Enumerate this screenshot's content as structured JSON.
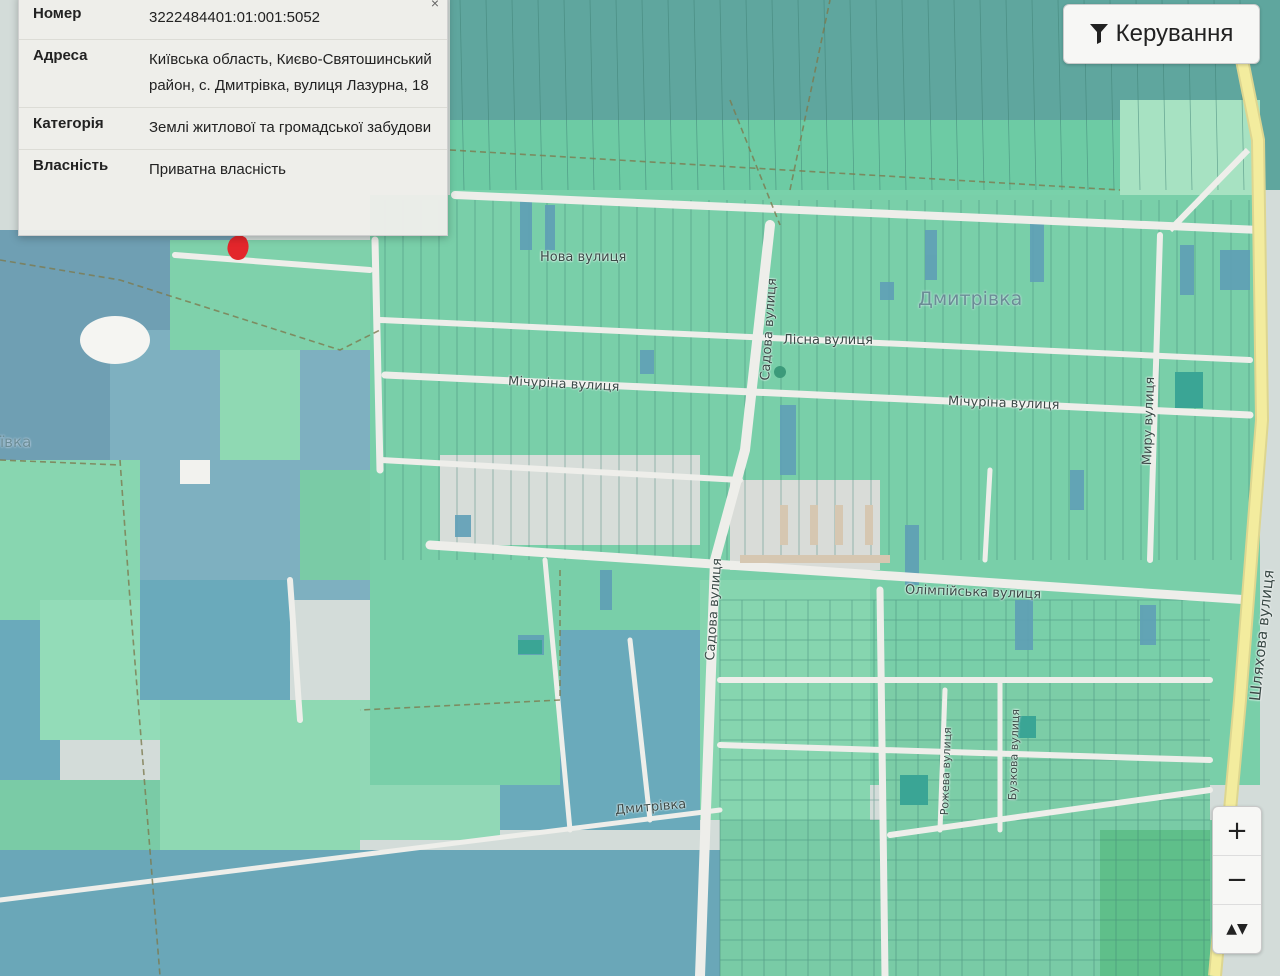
{
  "info_panel": {
    "close": "×",
    "rows": [
      {
        "key": "Номер",
        "value": "3222484401:01:001:5052"
      },
      {
        "key": "Адреса",
        "value": "Київська область, Києво-Святошинський район, с. Дмитрівка, вулиця Лазурна, 18"
      },
      {
        "key": "Категорія",
        "value": "Землі житлової та громадської забудови"
      },
      {
        "key": "Власність",
        "value": "Приватна власність"
      }
    ]
  },
  "controls": {
    "filter_label": "Керування",
    "zoom_in": "+",
    "zoom_out": "−",
    "compass": "▲▼"
  },
  "map": {
    "village_label": "Дмитрівка",
    "village_label_left": "ївка",
    "village_label_bottom": "Дмитрівка",
    "streets": {
      "nova": "Нова вулиця",
      "lisna": "Лісна вулиця",
      "michurina_1": "Мічуріна вулиця",
      "michurina_2": "Мічуріна вулиця",
      "sadova_1": "Садова вулиця",
      "sadova_2": "Садова вулиця",
      "olimpiyska": "Олімпійська вулиця",
      "myru": "Миру вулиця",
      "shlyakhova": "Шляхова вулиця",
      "rozheva": "Рожева вулиця",
      "buzkova": "Бузкова вулиця"
    },
    "colors": {
      "water": "#6f9fb3",
      "parcel_green": "#7fd6ae",
      "parcel_light": "#9de3c0",
      "parcel_blue": "#6aaabb",
      "parcel_teal": "#3aa595",
      "road": "#eeeeea",
      "highway": "#f1ea9e",
      "marker": "#e3262b"
    }
  }
}
